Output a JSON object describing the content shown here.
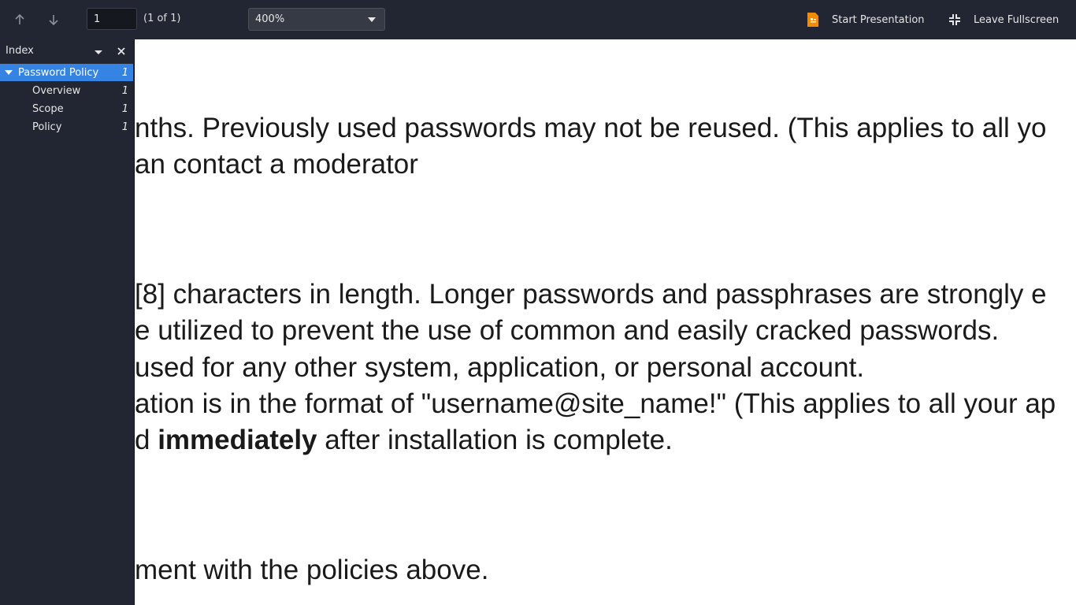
{
  "toolbar": {
    "page_input_value": "1",
    "page_count": "(1 of 1)",
    "zoom_value": "400%",
    "start_presentation": "Start Presentation",
    "leave_fullscreen": "Leave Fullscreen",
    "icons": {
      "prev": "arrow-up-icon",
      "next": "arrow-down-icon",
      "zoom_dropdown": "chevron-down-icon",
      "presentation": "presentation-icon",
      "fullscreen": "leave-fullscreen-icon"
    },
    "presentation_icon_color": "#f28a0a"
  },
  "sidebar": {
    "title": "Index",
    "items": [
      {
        "label": "Password Policy",
        "page": "1",
        "expanded": true,
        "selected": true
      },
      {
        "label": "Overview",
        "page": "1"
      },
      {
        "label": "Scope",
        "page": "1"
      },
      {
        "label": "Policy",
        "page": "1"
      }
    ],
    "selected_color": "#3584e4"
  },
  "document": {
    "lines": [
      "nths. Previously used passwords may not be reused. (This applies to all yo",
      "an contact a moderator",
      "[8] characters in length. Longer passwords and passphrases are strongly e",
      "e utilized to prevent the use of common and easily cracked passwords.",
      " used for any other system, application, or personal account.",
      "ation is in the format of \"username@site_name!\" (This applies to all your ap",
      "ment with the policies above."
    ],
    "line_6_prefix": "d ",
    "line_6_bold": "immediately",
    "line_6_suffix": " after installation is complete."
  }
}
